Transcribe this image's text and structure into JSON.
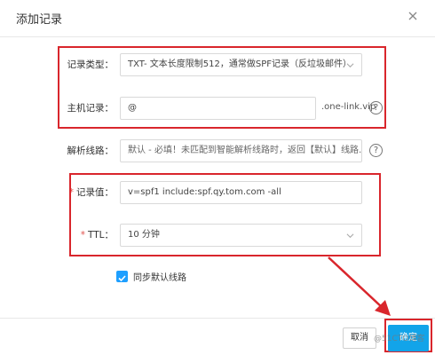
{
  "dialog": {
    "title": "添加记录",
    "close_icon": "close-icon"
  },
  "form": {
    "record_type": {
      "label": "记录类型：",
      "value": "TXT- 文本长度限制512，通常做SPF记录（反垃圾邮件）"
    },
    "host": {
      "label": "主机记录：",
      "value": "@",
      "suffix": ".one-link.vip",
      "help_glyph": "?"
    },
    "line": {
      "label": "解析线路：",
      "value": "默认 - 必填！未匹配到智能解析线路时，返回【默认】线路…",
      "help_glyph": "?"
    },
    "record_value": {
      "required_mark": "*",
      "label": "记录值：",
      "value": "v=spf1 include:spf.qy.tom.com -all"
    },
    "ttl": {
      "required_mark": "*",
      "label": "TTL：",
      "value": "10 分钟"
    },
    "sync": {
      "label": "同步默认线路",
      "checked": true
    }
  },
  "footer": {
    "cancel_label": "取消",
    "ok_label": "确定"
  },
  "watermark": "@51CTO博客",
  "colors": {
    "annotation_red": "#d9262c",
    "primary": "#12a4e9",
    "checkbox": "#1e9fff"
  }
}
